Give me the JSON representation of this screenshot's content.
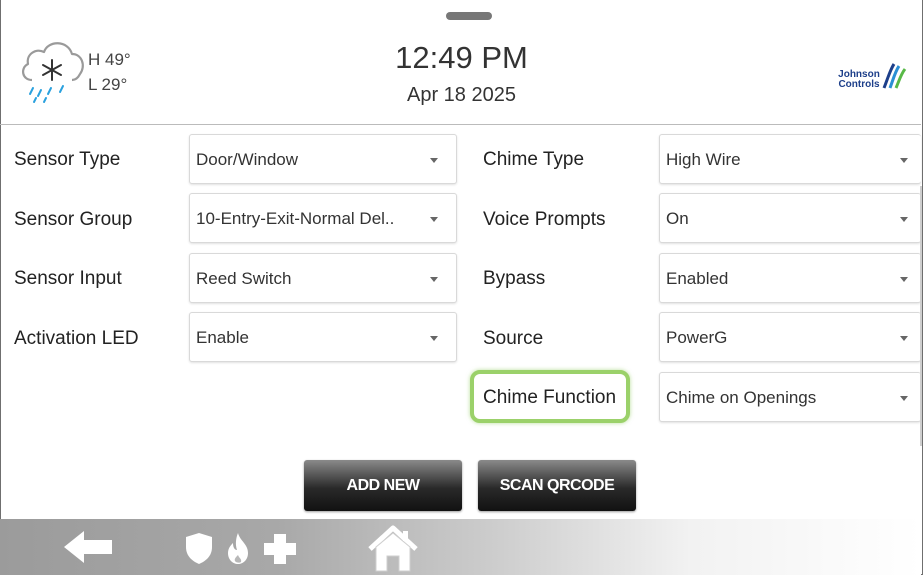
{
  "header": {
    "weather": {
      "icon": "snow-cloud-icon",
      "high": "H 49°",
      "low": "L 29°"
    },
    "time": "12:49 PM",
    "date": "Apr 18 2025",
    "logo": {
      "line1": "Johnson",
      "line2": "Controls",
      "color": "#1d3f8a"
    }
  },
  "left_fields": [
    {
      "label": "Sensor Type",
      "value": "Door/Window"
    },
    {
      "label": "Sensor Group",
      "value": "10-Entry-Exit-Normal Del.."
    },
    {
      "label": "Sensor Input",
      "value": "Reed Switch"
    },
    {
      "label": "Activation LED",
      "value": "Enable"
    }
  ],
  "right_fields": [
    {
      "label": "Chime Type",
      "value": "High Wire"
    },
    {
      "label": "Voice Prompts",
      "value": "On"
    },
    {
      "label": "Bypass",
      "value": "Enabled"
    },
    {
      "label": "Source",
      "value": "PowerG"
    },
    {
      "label": "Chime Function",
      "value": "Chime on Openings"
    }
  ],
  "buttons": {
    "add_new": "ADD NEW",
    "scan_qrcode": "SCAN QRCODE"
  },
  "bottom_nav": {
    "back": "back-arrow-icon",
    "security": "shield-icon",
    "fire": "fire-icon",
    "medical": "medical-cross-icon",
    "home": "home-icon"
  },
  "colors": {
    "highlight": "#9bd16a"
  }
}
